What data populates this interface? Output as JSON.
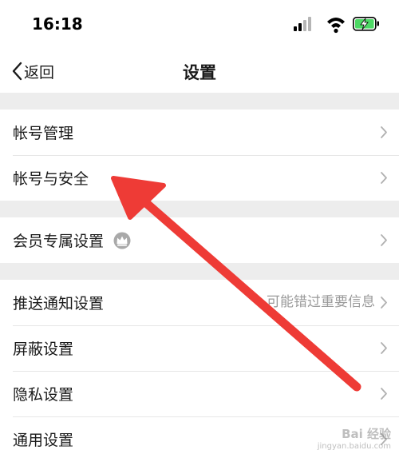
{
  "status_bar": {
    "time": "16:18",
    "icons": [
      "cellular-signal-icon",
      "wifi-icon",
      "battery-charging-icon"
    ],
    "battery_color": "#4cd964"
  },
  "nav": {
    "back_label": "返回",
    "title": "设置"
  },
  "groups": [
    {
      "items": [
        {
          "label": "帐号管理"
        },
        {
          "label": "帐号与安全"
        }
      ]
    },
    {
      "items": [
        {
          "label": "会员专属设置",
          "badge_icon": "crown-icon"
        }
      ]
    },
    {
      "items": [
        {
          "label": "推送通知设置",
          "hint": "可能错过重要信息"
        },
        {
          "label": "屏蔽设置"
        },
        {
          "label": "隐私设置"
        },
        {
          "label": "通用设置"
        }
      ]
    }
  ],
  "annotation": {
    "icon": "red-arrow-annotation-icon",
    "color": "#ee3b36"
  },
  "watermark": {
    "main": "Bai 经验",
    "sub": "jingyan.baidu.com"
  }
}
